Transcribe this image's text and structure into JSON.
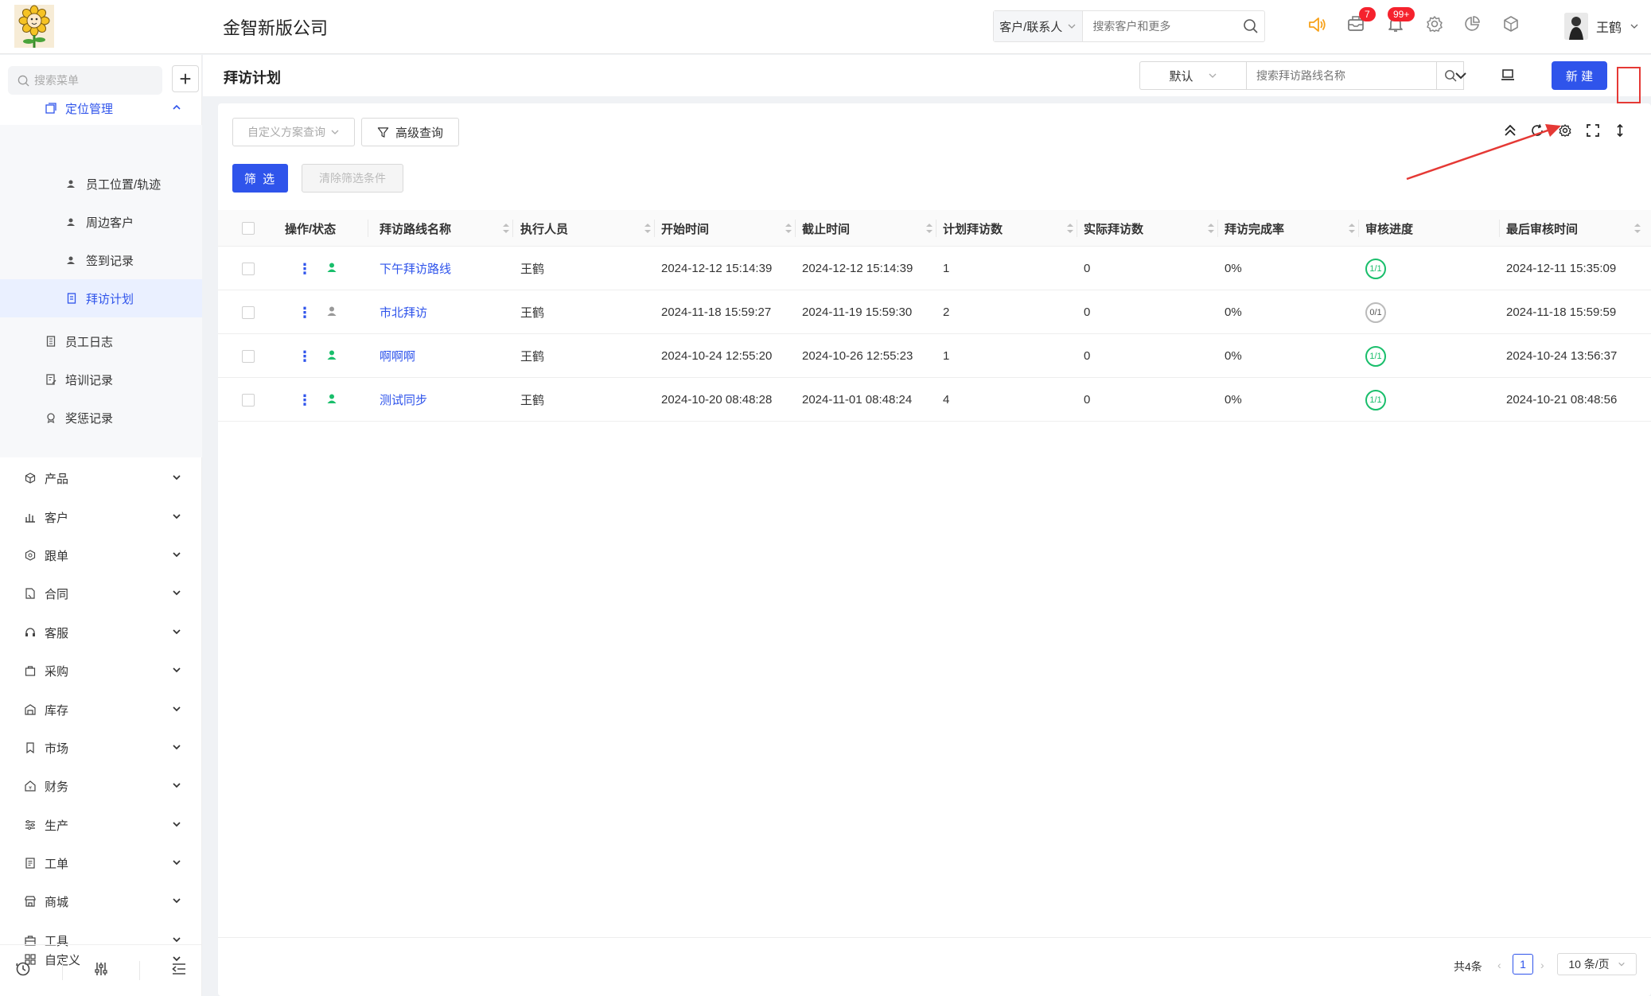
{
  "header": {
    "company": "金智新版公司",
    "search_scope": "客户/联系人",
    "search_placeholder": "搜索客户和更多",
    "mail_badge": "7",
    "notice_badge": "99+",
    "user_name": "王鹤"
  },
  "sidebar": {
    "search_placeholder": "搜索菜单",
    "open_group": "定位管理",
    "sub_items": [
      "员工位置/轨迹",
      "周边客户",
      "签到记录",
      "拜访计划"
    ],
    "active_item": "拜访计划",
    "items_mid": [
      "员工日志",
      "培训记录",
      "奖惩记录"
    ],
    "groups": [
      "产品",
      "客户",
      "跟单",
      "合同",
      "客服",
      "采购",
      "库存",
      "市场",
      "财务",
      "生产",
      "工单",
      "商城",
      "工具",
      "自定义"
    ]
  },
  "page": {
    "title": "拜访计划",
    "plan_select": "默认",
    "search_placeholder": "搜索拜访路线名称",
    "new_label": "新 建"
  },
  "toolbar": {
    "custom_query": "自定义方案查询",
    "advanced_query": "高级查询",
    "filter": "筛 选",
    "clear_filter": "清除筛选条件"
  },
  "table": {
    "columns": [
      "操作/状态",
      "拜访路线名称",
      "执行人员",
      "开始时间",
      "截止时间",
      "计划拜访数",
      "实际拜访数",
      "拜访完成率",
      "审核进度",
      "最后审核时间"
    ],
    "rows": [
      {
        "name": "下午拜访路线",
        "executor": "王鹤",
        "start": "2024-12-12 15:14:39",
        "end": "2024-12-12 15:14:39",
        "planned": "1",
        "actual": "0",
        "rate": "0%",
        "progress": "1/1",
        "done": true,
        "last_review": "2024-12-11 15:35:09"
      },
      {
        "name": "市北拜访",
        "executor": "王鹤",
        "start": "2024-11-18 15:59:27",
        "end": "2024-11-19 15:59:30",
        "planned": "2",
        "actual": "0",
        "rate": "0%",
        "progress": "0/1",
        "done": false,
        "last_review": "2024-11-18 15:59:59"
      },
      {
        "name": "啊啊啊",
        "executor": "王鹤",
        "start": "2024-10-24 12:55:20",
        "end": "2024-10-26 12:55:23",
        "planned": "1",
        "actual": "0",
        "rate": "0%",
        "progress": "1/1",
        "done": true,
        "last_review": "2024-10-24 13:56:37"
      },
      {
        "name": "测试同步",
        "executor": "王鹤",
        "start": "2024-10-20 08:48:28",
        "end": "2024-11-01 08:48:24",
        "planned": "4",
        "actual": "0",
        "rate": "0%",
        "progress": "1/1",
        "done": true,
        "last_review": "2024-10-21 08:48:56"
      }
    ]
  },
  "pagination": {
    "total": "共4条",
    "current_page": "1",
    "page_size": "10 条/页"
  },
  "colors": {
    "primary": "#2f54eb",
    "success": "#19be6b",
    "annotation": "#e53935"
  }
}
